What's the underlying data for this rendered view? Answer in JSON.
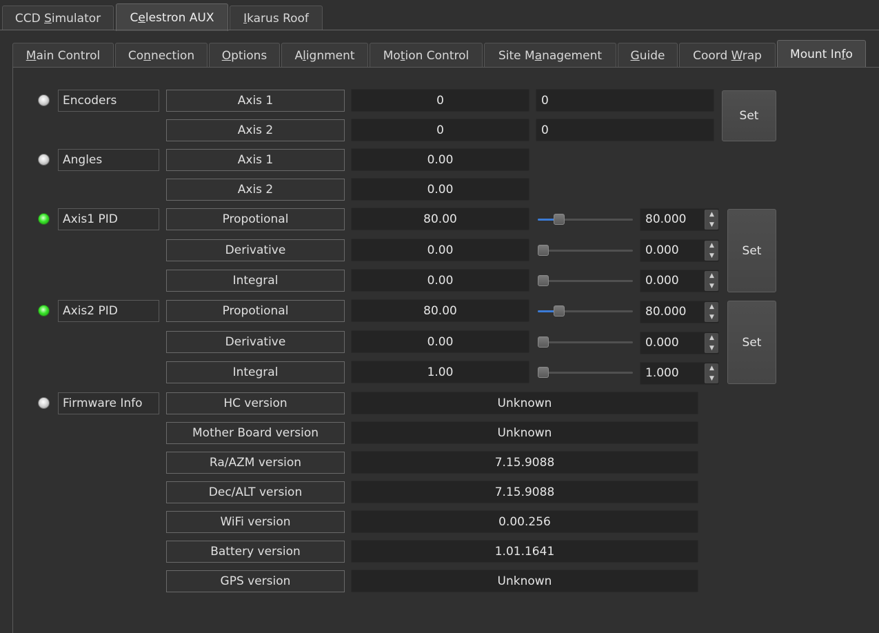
{
  "top_tabs": [
    {
      "pre": "CCD ",
      "mn": "S",
      "post": "imulator"
    },
    {
      "pre": "C",
      "mn": "e",
      "post": "lestron AUX"
    },
    {
      "pre": "",
      "mn": "I",
      "post": "karus Roof"
    }
  ],
  "sub_tabs": [
    {
      "pre": "",
      "mn": "M",
      "post": "ain Control"
    },
    {
      "pre": "Co",
      "mn": "n",
      "post": "nection"
    },
    {
      "pre": "",
      "mn": "O",
      "post": "ptions"
    },
    {
      "pre": "A",
      "mn": "l",
      "post": "ignment"
    },
    {
      "pre": "Mo",
      "mn": "t",
      "post": "ion Control"
    },
    {
      "pre": "Site M",
      "mn": "a",
      "post": "nagement"
    },
    {
      "pre": "",
      "mn": "G",
      "post": "uide"
    },
    {
      "pre": "Coord ",
      "mn": "W",
      "post": "rap"
    },
    {
      "pre": "Mount In",
      "mn": "f",
      "post": "o"
    }
  ],
  "encoders": {
    "title": "Encoders",
    "axis1_label": "Axis 1",
    "axis1_value": "0",
    "axis1_input": "0",
    "axis2_label": "Axis 2",
    "axis2_value": "0",
    "axis2_input": "0",
    "set_label": "Set"
  },
  "angles": {
    "title": "Angles",
    "axis1_label": "Axis 1",
    "axis1_value": "0.00",
    "axis2_label": "Axis 2",
    "axis2_value": "0.00"
  },
  "axis1_pid": {
    "title": "Axis1 PID",
    "p_label": "Propotional",
    "p_value": "80.00",
    "p_spin": "80.000",
    "p_level": 0.19,
    "d_label": "Derivative",
    "d_value": "0.00",
    "d_spin": "0.000",
    "d_level": 0,
    "i_label": "Integral",
    "i_value": "0.00",
    "i_spin": "0.000",
    "i_level": 0,
    "set_label": "Set"
  },
  "axis2_pid": {
    "title": "Axis2 PID",
    "p_label": "Propotional",
    "p_value": "80.00",
    "p_spin": "80.000",
    "p_level": 0.19,
    "d_label": "Derivative",
    "d_value": "0.00",
    "d_spin": "0.000",
    "d_level": 0,
    "i_label": "Integral",
    "i_value": "1.00",
    "i_spin": "1.000",
    "i_level": 0,
    "set_label": "Set"
  },
  "firmware": {
    "title": "Firmware Info",
    "rows": [
      {
        "label": "HC version",
        "value": "Unknown"
      },
      {
        "label": "Mother Board version",
        "value": "Unknown"
      },
      {
        "label": "Ra/AZM version",
        "value": "7.15.9088"
      },
      {
        "label": "Dec/ALT version",
        "value": "7.15.9088"
      },
      {
        "label": "WiFi version",
        "value": "0.00.256"
      },
      {
        "label": "Battery version",
        "value": "1.01.1641"
      },
      {
        "label": "GPS version",
        "value": "Unknown"
      }
    ]
  },
  "colors": {
    "background": "#303030",
    "field": "#242424",
    "led_ok": "#39e52a",
    "led_idle": "#d7d7d7",
    "slider_fill": "#3b7bd6"
  }
}
